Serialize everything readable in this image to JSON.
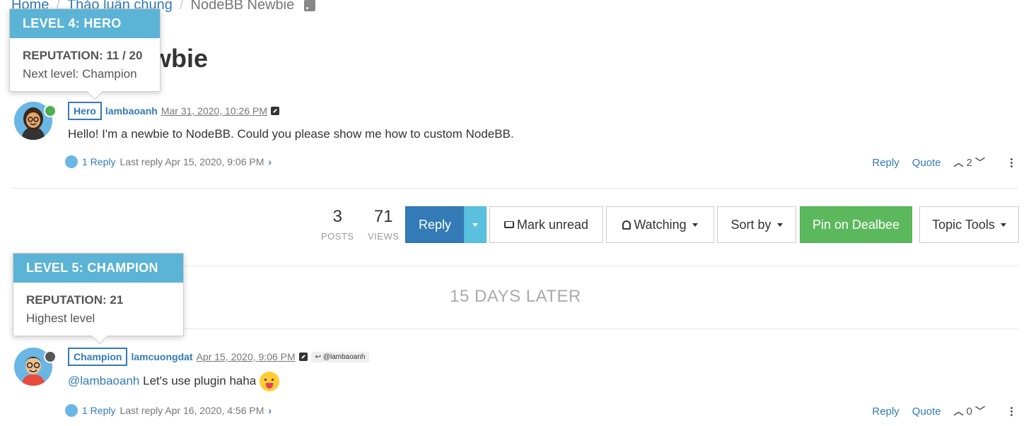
{
  "breadcrumb": {
    "home": "Home",
    "category": "Thảo luận chung",
    "current": "NodeBB Newbie"
  },
  "topic": {
    "title": "NodeBB Newbie"
  },
  "tooltips": [
    {
      "header": "LEVEL 4: HERO",
      "reputation": "REPUTATION: 11 / 20",
      "note": "Next level: Champion"
    },
    {
      "header": "LEVEL 5: CHAMPION",
      "reputation": "REPUTATION: 21",
      "note": "Highest level"
    }
  ],
  "posts": [
    {
      "badge": "Hero",
      "username": "lambaoanh",
      "timestamp": "Mar 31, 2020, 10:26 PM",
      "content": "Hello! I'm a newbie to NodeBB. Could you please show me how to custom NodeBB.",
      "replies_link": "1 Reply",
      "last_reply": "Last reply Apr 15, 2020, 9:06 PM",
      "reply_label": "Reply",
      "quote_label": "Quote",
      "votes": "2",
      "status_color": "#4cae4c"
    },
    {
      "badge": "Champion",
      "username": "lamcuongdat",
      "timestamp": "Apr 15, 2020, 9:06 PM",
      "reply_to": "@lambaoanh",
      "mention": "@lambaoanh",
      "content": " Let's use plugin haha ",
      "replies_link": "1 Reply",
      "last_reply": "Last reply Apr 16, 2020, 4:56 PM",
      "reply_label": "Reply",
      "quote_label": "Quote",
      "votes": "0",
      "status_color": "#555555"
    }
  ],
  "stats": {
    "posts_count": "3",
    "posts_label": "POSTS",
    "views_count": "71",
    "views_label": "VIEWS"
  },
  "toolbar": {
    "reply": "Reply",
    "mark_unread": "Mark unread",
    "watching": "Watching",
    "sort_by": "Sort by",
    "pin": "Pin on Dealbee",
    "topic_tools": "Topic Tools"
  },
  "timeline": {
    "gap_label": "15 DAYS LATER"
  },
  "colors": {
    "link": "#337ab7",
    "tooltip_header": "#5bb3d5",
    "success": "#5cb85c",
    "info": "#5bc0de"
  }
}
